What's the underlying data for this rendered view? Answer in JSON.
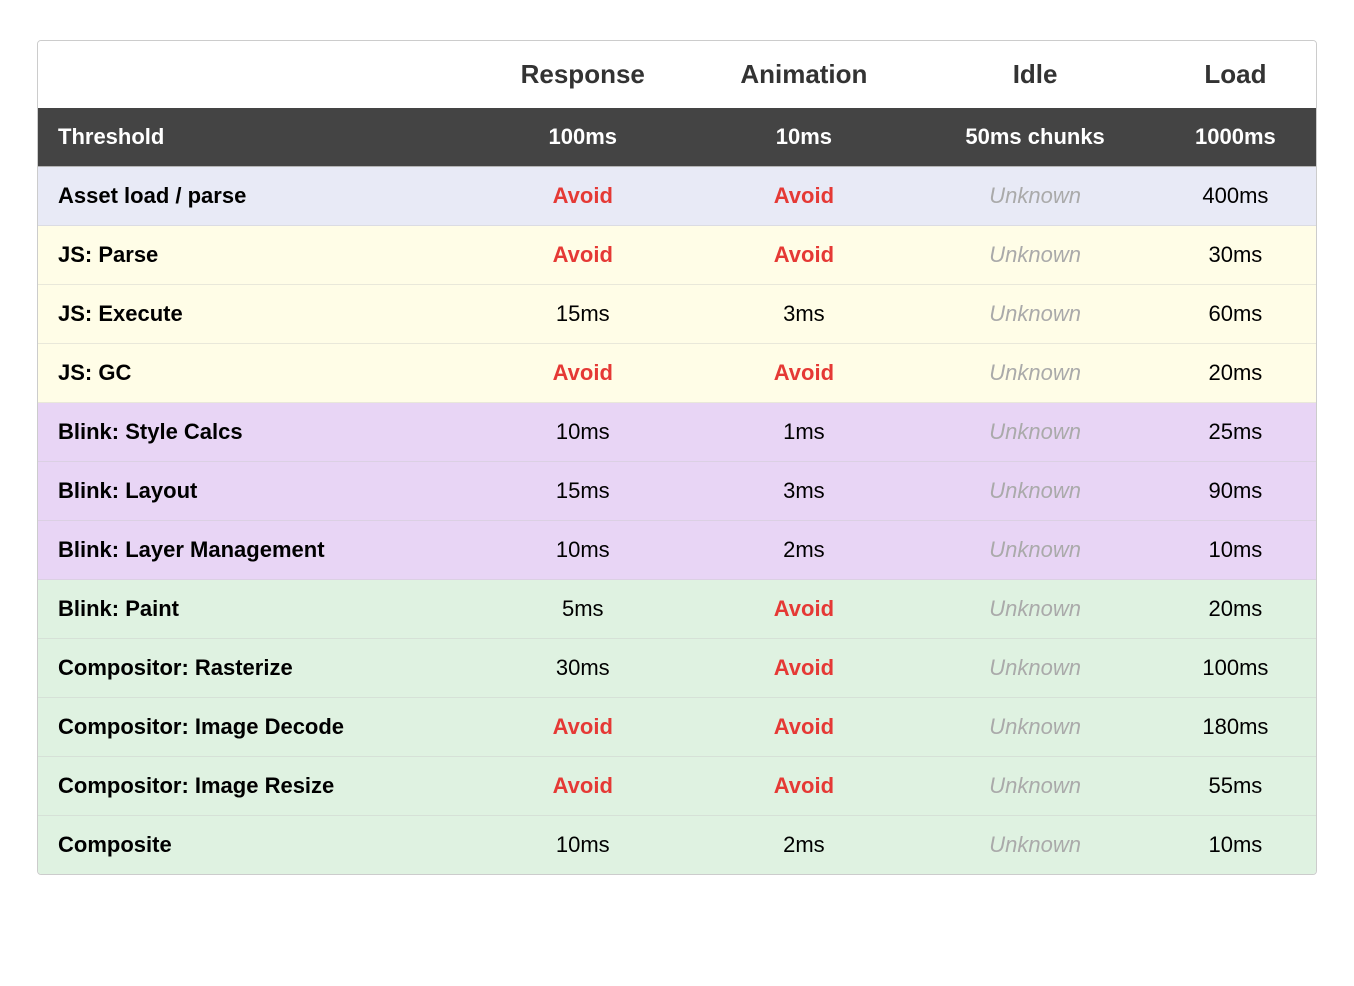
{
  "columns": {
    "threshold": "Threshold",
    "response": "Response",
    "animation": "Animation",
    "idle": "Idle",
    "load": "Load"
  },
  "header_row": {
    "threshold": "Threshold",
    "response": "100ms",
    "animation": "10ms",
    "idle": "50ms chunks",
    "load": "1000ms"
  },
  "rows": [
    {
      "name": "Asset load / parse",
      "response": "Avoid",
      "response_type": "avoid",
      "animation": "Avoid",
      "animation_type": "avoid",
      "idle": "Unknown",
      "idle_type": "unknown",
      "load": "400ms",
      "load_type": "normal",
      "color": "blue"
    },
    {
      "name": "JS: Parse",
      "response": "Avoid",
      "response_type": "avoid",
      "animation": "Avoid",
      "animation_type": "avoid",
      "idle": "Unknown",
      "idle_type": "unknown",
      "load": "30ms",
      "load_type": "normal",
      "color": "yellow"
    },
    {
      "name": "JS: Execute",
      "response": "15ms",
      "response_type": "normal",
      "animation": "3ms",
      "animation_type": "normal",
      "idle": "Unknown",
      "idle_type": "unknown",
      "load": "60ms",
      "load_type": "normal",
      "color": "yellow"
    },
    {
      "name": "JS: GC",
      "response": "Avoid",
      "response_type": "avoid",
      "animation": "Avoid",
      "animation_type": "avoid",
      "idle": "Unknown",
      "idle_type": "unknown",
      "load": "20ms",
      "load_type": "normal",
      "color": "yellow"
    },
    {
      "name": "Blink: Style Calcs",
      "response": "10ms",
      "response_type": "normal",
      "animation": "1ms",
      "animation_type": "normal",
      "idle": "Unknown",
      "idle_type": "unknown",
      "load": "25ms",
      "load_type": "normal",
      "color": "purple"
    },
    {
      "name": "Blink: Layout",
      "response": "15ms",
      "response_type": "normal",
      "animation": "3ms",
      "animation_type": "normal",
      "idle": "Unknown",
      "idle_type": "unknown",
      "load": "90ms",
      "load_type": "normal",
      "color": "purple"
    },
    {
      "name": "Blink: Layer Management",
      "response": "10ms",
      "response_type": "normal",
      "animation": "2ms",
      "animation_type": "normal",
      "idle": "Unknown",
      "idle_type": "unknown",
      "load": "10ms",
      "load_type": "normal",
      "color": "purple"
    },
    {
      "name": "Blink: Paint",
      "response": "5ms",
      "response_type": "normal",
      "animation": "Avoid",
      "animation_type": "avoid",
      "idle": "Unknown",
      "idle_type": "unknown",
      "load": "20ms",
      "load_type": "normal",
      "color": "green"
    },
    {
      "name": "Compositor: Rasterize",
      "response": "30ms",
      "response_type": "normal",
      "animation": "Avoid",
      "animation_type": "avoid",
      "idle": "Unknown",
      "idle_type": "unknown",
      "load": "100ms",
      "load_type": "normal",
      "color": "green"
    },
    {
      "name": "Compositor: Image Decode",
      "response": "Avoid",
      "response_type": "avoid",
      "animation": "Avoid",
      "animation_type": "avoid",
      "idle": "Unknown",
      "idle_type": "unknown",
      "load": "180ms",
      "load_type": "normal",
      "color": "green"
    },
    {
      "name": "Compositor: Image Resize",
      "response": "Avoid",
      "response_type": "avoid",
      "animation": "Avoid",
      "animation_type": "avoid",
      "idle": "Unknown",
      "idle_type": "unknown",
      "load": "55ms",
      "load_type": "normal",
      "color": "green"
    },
    {
      "name": "Composite",
      "response": "10ms",
      "response_type": "normal",
      "animation": "2ms",
      "animation_type": "normal",
      "idle": "Unknown",
      "idle_type": "unknown",
      "load": "10ms",
      "load_type": "normal",
      "color": "green"
    }
  ]
}
